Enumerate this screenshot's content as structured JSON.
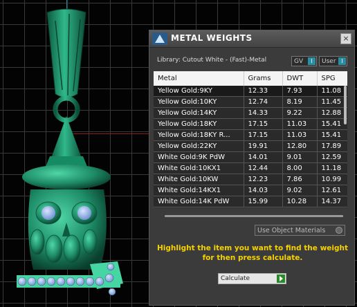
{
  "panel": {
    "title": "METAL WEIGHTS",
    "close_icon": "×",
    "library_label": "Library: Cutout White - (Fast)-Metal",
    "toggles": [
      {
        "label": "GV",
        "indicator": "I"
      },
      {
        "label": "User",
        "indicator": "I"
      }
    ],
    "table": {
      "headers": [
        "Metal",
        "Grams",
        "DWT",
        "SPG"
      ],
      "rows": [
        {
          "metal": "Yellow Gold:9KY",
          "grams": "12.33",
          "dwt": "7.93",
          "spg": "11.08"
        },
        {
          "metal": "Yellow Gold:10KY",
          "grams": "12.74",
          "dwt": "8.19",
          "spg": "11.45"
        },
        {
          "metal": "Yellow Gold:14KY",
          "grams": "14.33",
          "dwt": "9.22",
          "spg": "12.88"
        },
        {
          "metal": "Yellow Gold:18KY",
          "grams": "17.15",
          "dwt": "11.03",
          "spg": "15.41"
        },
        {
          "metal": "Yellow Gold:18KY R...",
          "grams": "17.15",
          "dwt": "11.03",
          "spg": "15.41"
        },
        {
          "metal": "Yellow Gold:22KY",
          "grams": "19.91",
          "dwt": "12.80",
          "spg": "17.89"
        },
        {
          "metal": "White Gold:9K PdW",
          "grams": "14.01",
          "dwt": "9.01",
          "spg": "12.59"
        },
        {
          "metal": "White Gold:10KX1",
          "grams": "12.44",
          "dwt": "8.00",
          "spg": "11.18"
        },
        {
          "metal": "White Gold:10KW",
          "grams": "12.23",
          "dwt": "7.86",
          "spg": "10.99"
        },
        {
          "metal": "White Gold:14KX1",
          "grams": "14.03",
          "dwt": "9.02",
          "spg": "12.61"
        },
        {
          "metal": "White Gold:14K PdW",
          "grams": "15.99",
          "dwt": "10.28",
          "spg": "14.37"
        }
      ]
    },
    "use_object_materials": "Use Object Materials",
    "hint": "Highlight the item you want to find the weight for then press calculate.",
    "calculate_label": "Calculate"
  },
  "colors": {
    "hint_text": "#f5d200",
    "model": "#1d8a66",
    "gems": "#8fb4e6",
    "panel_bg": "#3b3b3b"
  }
}
